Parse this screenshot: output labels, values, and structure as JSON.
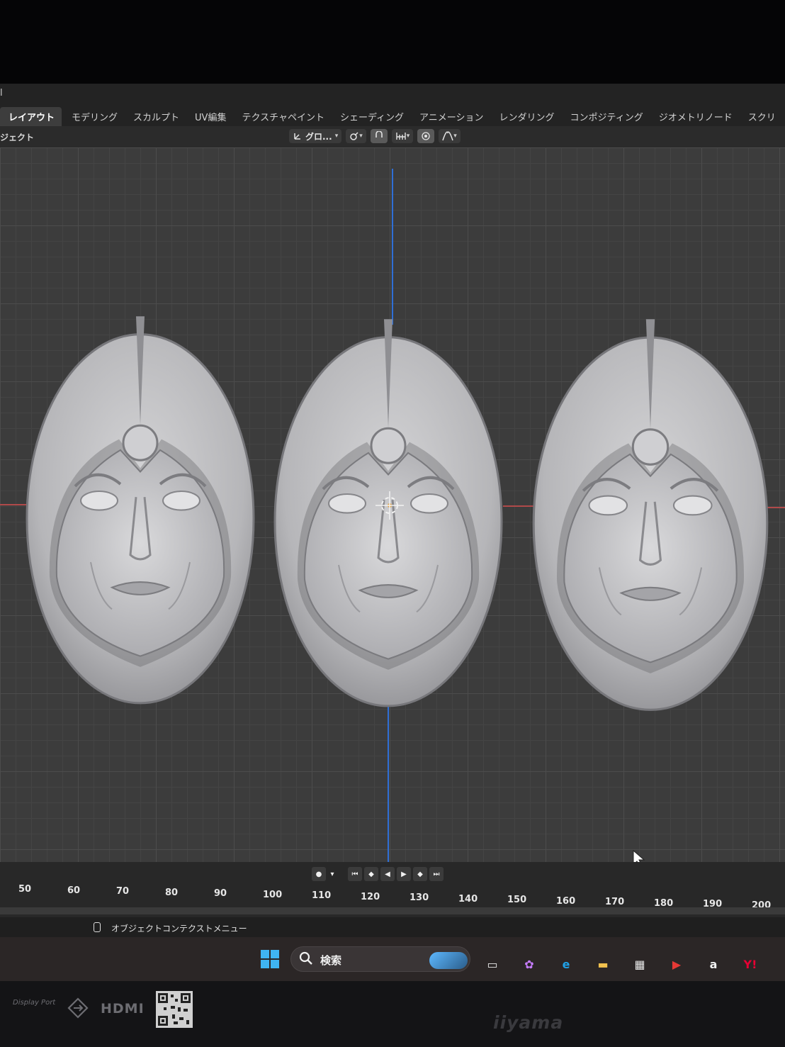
{
  "app": {
    "menu_glyph": "l",
    "workspace_tabs": [
      {
        "label": "レイアウト",
        "active": true
      },
      {
        "label": "モデリング",
        "active": false
      },
      {
        "label": "スカルプト",
        "active": false
      },
      {
        "label": "UV編集",
        "active": false
      },
      {
        "label": "テクスチャペイント",
        "active": false
      },
      {
        "label": "シェーディング",
        "active": false
      },
      {
        "label": "アニメーション",
        "active": false
      },
      {
        "label": "レンダリング",
        "active": false
      },
      {
        "label": "コンポジティング",
        "active": false
      },
      {
        "label": "ジオメトリノード",
        "active": false
      },
      {
        "label": "スクリ",
        "active": false
      }
    ]
  },
  "header": {
    "object_menu": "ジェクト",
    "transform_orientation": "グロ...",
    "icons": [
      "transform-orientation-icon",
      "pivot-point-icon",
      "snap-icon",
      "snap-increment-icon",
      "proportional-editing-icon",
      "falloff-icon"
    ]
  },
  "viewport": {
    "object_count": 3,
    "grid_color": "#4c4c4c",
    "background_color": "#3c3c3c",
    "axis_colors": {
      "y": "#2f6fd6",
      "x": "#b04a4a"
    }
  },
  "timeline": {
    "frame_labels": [
      "50",
      "60",
      "70",
      "80",
      "90",
      "100",
      "110",
      "120",
      "130",
      "140",
      "150",
      "160",
      "170",
      "180",
      "190",
      "200"
    ],
    "playback_buttons": [
      "jump-start-icon",
      "prev-keyframe-icon",
      "play-reverse-icon",
      "play-icon",
      "next-keyframe-icon",
      "jump-end-icon"
    ]
  },
  "status_bar": {
    "text": "オブジェクトコンテクストメニュー"
  },
  "taskbar": {
    "search_label": "検索",
    "apps": [
      {
        "name": "task-view",
        "glyph": "▭",
        "color": "#e8e8e8"
      },
      {
        "name": "copilot",
        "glyph": "✿",
        "color": "#c77dff"
      },
      {
        "name": "edge",
        "glyph": "e",
        "color": "#1fa1e8"
      },
      {
        "name": "file-explorer",
        "glyph": "▬",
        "color": "#f2c14e"
      },
      {
        "name": "microsoft-store",
        "glyph": "▦",
        "color": "#e9e9e9"
      },
      {
        "name": "youtube",
        "glyph": "▶",
        "color": "#e53935"
      },
      {
        "name": "amazon",
        "glyph": "a",
        "color": "#f1f1f1"
      },
      {
        "name": "yahoo",
        "glyph": "Y!",
        "color": "#e60033"
      }
    ]
  },
  "bezel": {
    "port_dp": "Display Port",
    "port_hdmi": "HDMI",
    "brand": "iiyama"
  }
}
